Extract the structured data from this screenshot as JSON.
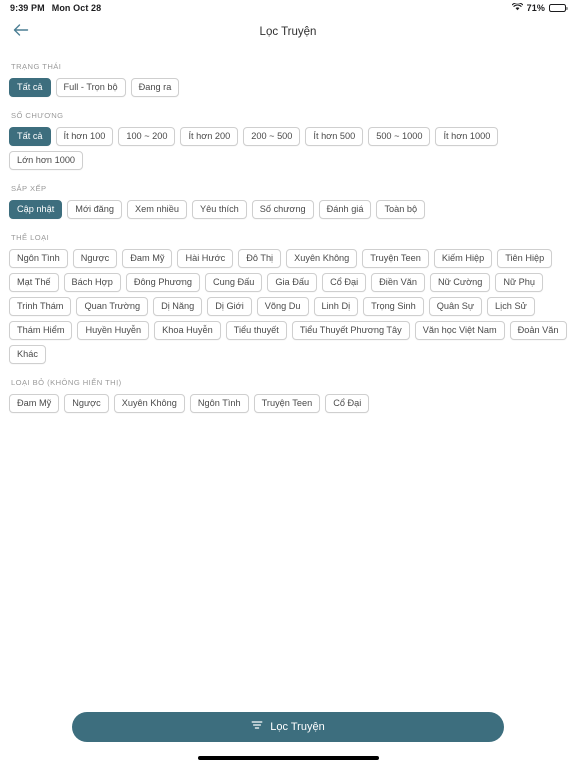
{
  "status_bar": {
    "time": "9:39 PM",
    "date": "Mon Oct 28",
    "wifi_icon": "wifi-icon",
    "battery_percent": "71%",
    "battery_level": 71
  },
  "nav": {
    "back_icon": "arrow-left-icon",
    "title": "Lọc Truyện"
  },
  "colors": {
    "accent": "#3d6e7e",
    "chip_border": "#cfcfcf",
    "chip_text": "#4a4a4a",
    "section_title": "#9a9a9a"
  },
  "sections": [
    {
      "key": "trang-thai",
      "title": "TRẠNG THÁI",
      "chips": [
        {
          "label": "Tất cả",
          "selected": true
        },
        {
          "label": "Full - Trọn bộ",
          "selected": false
        },
        {
          "label": "Đang ra",
          "selected": false
        }
      ]
    },
    {
      "key": "so-chuong",
      "title": "SỐ CHƯƠNG",
      "chips": [
        {
          "label": "Tất cả",
          "selected": true
        },
        {
          "label": "Ít hơn 100",
          "selected": false
        },
        {
          "label": "100 ~ 200",
          "selected": false
        },
        {
          "label": "Ít hơn 200",
          "selected": false
        },
        {
          "label": "200 ~ 500",
          "selected": false
        },
        {
          "label": "Ít hơn 500",
          "selected": false
        },
        {
          "label": "500 ~ 1000",
          "selected": false
        },
        {
          "label": "Ít hơn 1000",
          "selected": false
        },
        {
          "label": "Lớn hơn 1000",
          "selected": false
        }
      ]
    },
    {
      "key": "sap-xep",
      "title": "SẮP XẾP",
      "chips": [
        {
          "label": "Cập nhật",
          "selected": true
        },
        {
          "label": "Mới đăng",
          "selected": false
        },
        {
          "label": "Xem nhiều",
          "selected": false
        },
        {
          "label": "Yêu thích",
          "selected": false
        },
        {
          "label": "Số chương",
          "selected": false
        },
        {
          "label": "Đánh giá",
          "selected": false
        },
        {
          "label": "Toàn bộ",
          "selected": false
        }
      ]
    },
    {
      "key": "the-loai",
      "title": "THỂ LOẠI",
      "chips": [
        {
          "label": "Ngôn Tình",
          "selected": false
        },
        {
          "label": "Ngược",
          "selected": false
        },
        {
          "label": "Đam Mỹ",
          "selected": false
        },
        {
          "label": "Hài Hước",
          "selected": false
        },
        {
          "label": "Đô Thị",
          "selected": false
        },
        {
          "label": "Xuyên Không",
          "selected": false
        },
        {
          "label": "Truyện Teen",
          "selected": false
        },
        {
          "label": "Kiếm Hiệp",
          "selected": false
        },
        {
          "label": "Tiên Hiệp",
          "selected": false
        },
        {
          "label": "Mạt Thế",
          "selected": false
        },
        {
          "label": "Bách Hợp",
          "selected": false
        },
        {
          "label": "Đông Phương",
          "selected": false
        },
        {
          "label": "Cung Đấu",
          "selected": false
        },
        {
          "label": "Gia Đấu",
          "selected": false
        },
        {
          "label": "Cổ Đại",
          "selected": false
        },
        {
          "label": "Điền Văn",
          "selected": false
        },
        {
          "label": "Nữ Cường",
          "selected": false
        },
        {
          "label": "Nữ Phụ",
          "selected": false
        },
        {
          "label": "Trinh Thám",
          "selected": false
        },
        {
          "label": "Quan Trường",
          "selected": false
        },
        {
          "label": "Dị Năng",
          "selected": false
        },
        {
          "label": "Dị Giới",
          "selected": false
        },
        {
          "label": "Võng Du",
          "selected": false
        },
        {
          "label": "Linh Dị",
          "selected": false
        },
        {
          "label": "Trọng Sinh",
          "selected": false
        },
        {
          "label": "Quân Sự",
          "selected": false
        },
        {
          "label": "Lịch Sử",
          "selected": false
        },
        {
          "label": "Thám Hiểm",
          "selected": false
        },
        {
          "label": "Huyền Huyễn",
          "selected": false
        },
        {
          "label": "Khoa Huyễn",
          "selected": false
        },
        {
          "label": "Tiểu thuyết",
          "selected": false
        },
        {
          "label": "Tiểu Thuyết Phương Tây",
          "selected": false
        },
        {
          "label": "Văn học Việt Nam",
          "selected": false
        },
        {
          "label": "Đoản Văn",
          "selected": false
        },
        {
          "label": "Khác",
          "selected": false
        }
      ]
    },
    {
      "key": "loai-bo",
      "title": "LOẠI BỎ (KHÔNG HIỂN THỊ)",
      "chips": [
        {
          "label": "Đam Mỹ",
          "selected": false
        },
        {
          "label": "Ngược",
          "selected": false
        },
        {
          "label": "Xuyên Không",
          "selected": false
        },
        {
          "label": "Ngôn Tình",
          "selected": false
        },
        {
          "label": "Truyện Teen",
          "selected": false
        },
        {
          "label": "Cổ Đại",
          "selected": false
        }
      ]
    }
  ],
  "bottom": {
    "filter_icon": "filter-icon",
    "filter_label": "Lọc Truyện"
  }
}
